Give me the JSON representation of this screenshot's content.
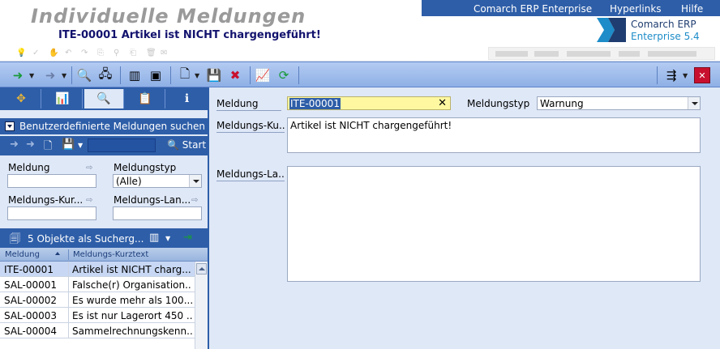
{
  "header": {
    "title": "Individuelle Meldungen",
    "subtitle": "ITE-00001 Artikel ist NICHT chargengeführt!",
    "nav": [
      "Comarch ERP Enterprise",
      "Hyperlinks",
      "Hilfe"
    ],
    "logo": {
      "line1": "Comarch ERP",
      "line2": "Enterprise",
      "version": "5.4"
    }
  },
  "left": {
    "section_title": "Benutzerdefinierte Meldungen suchen",
    "start_label": "Start",
    "fields": {
      "meldung_label": "Meldung",
      "meldungstyp_label": "Meldungstyp",
      "meldungstyp_value": "(Alle)",
      "kurz_label": "Meldungs-Kur...",
      "lang_label": "Meldungs-Lan..."
    },
    "results_label": "5 Objekte als Sucherg...",
    "columns": [
      "Meldung",
      "Meldungs-Kurztext"
    ],
    "rows": [
      {
        "id": "ITE-00001",
        "text": "Artikel ist NICHT charg..."
      },
      {
        "id": "SAL-00001",
        "text": "Falsche(r) Organisation..."
      },
      {
        "id": "SAL-00002",
        "text": "Es wurde mehr als 100..."
      },
      {
        "id": "SAL-00003",
        "text": "Es ist nur Lagerort 450 ..."
      },
      {
        "id": "SAL-00004",
        "text": "Sammelrechnungskenn..."
      }
    ]
  },
  "detail": {
    "meldung_label": "Meldung",
    "meldung_value": "ITE-00001",
    "typ_label": "Meldungstyp",
    "typ_value": "Warnung",
    "kurz_label": "Meldungs-Ku...",
    "kurz_value": "Artikel ist NICHT chargengeführt!",
    "lang_label": "Meldungs-La...",
    "lang_value": ""
  },
  "colors": {
    "accent": "#2e5ea8",
    "panel": "#dfe8f7",
    "highlight": "#fff8a0"
  }
}
